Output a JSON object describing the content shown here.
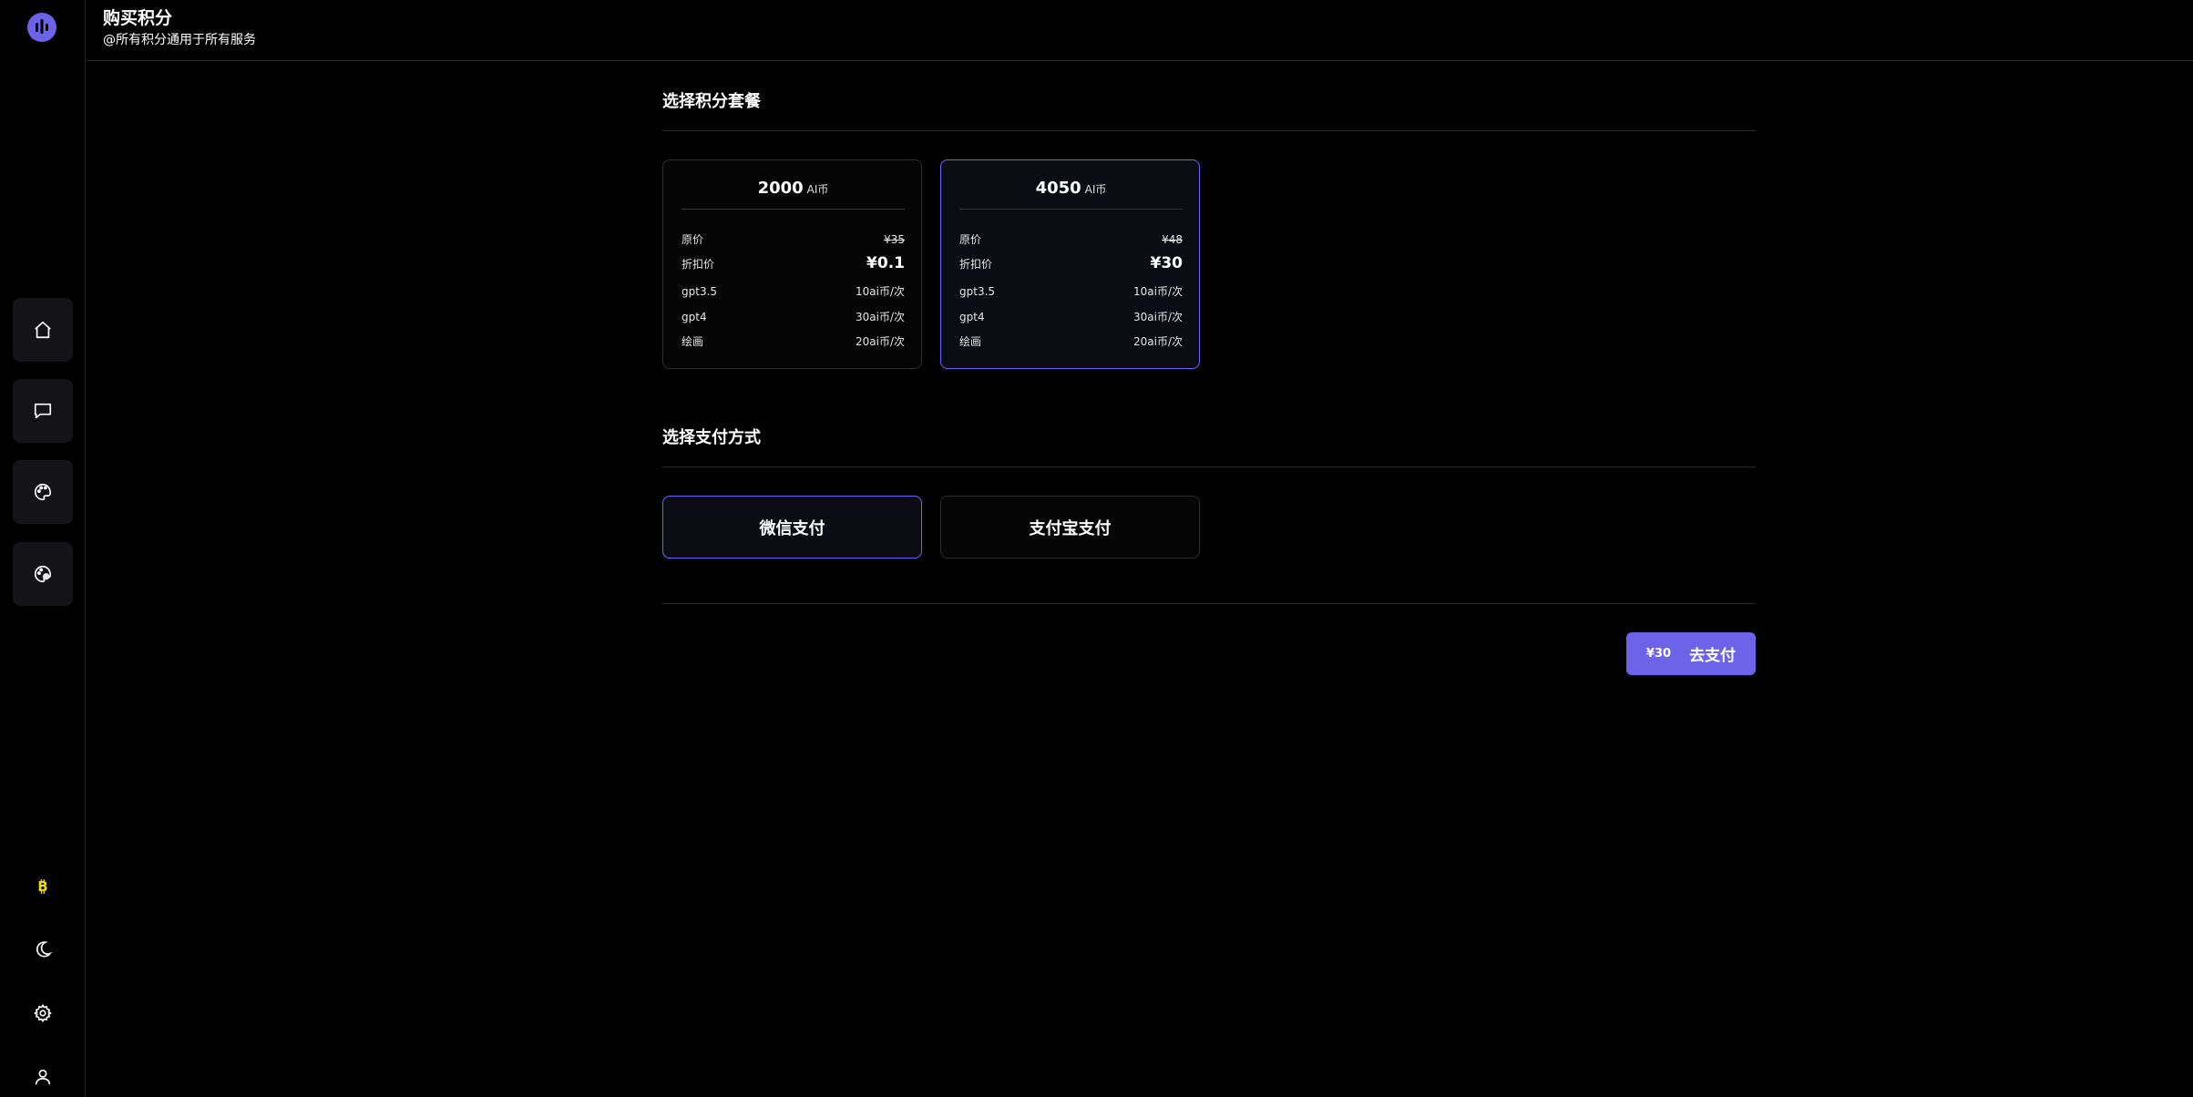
{
  "header": {
    "title": "购买积分",
    "subtitle": "@所有积分通用于所有服务"
  },
  "sidebar": {
    "logo_icon": "waveform-bubble-icon",
    "nav": [
      {
        "icon": "home-icon"
      },
      {
        "icon": "chat-icon"
      },
      {
        "icon": "palette-icon"
      },
      {
        "icon": "palette-settings-icon"
      }
    ],
    "bottom": [
      {
        "icon": "bitcoin-icon"
      },
      {
        "icon": "moon-icon"
      },
      {
        "icon": "gear-icon"
      },
      {
        "icon": "user-icon"
      }
    ]
  },
  "plans_section": {
    "title": "选择积分套餐",
    "plans": [
      {
        "amount": "2000",
        "unit": "AI币",
        "original_label": "原价",
        "original_price": "¥35",
        "discount_label": "折扣价",
        "discount_price": "¥0.1",
        "rows": [
          {
            "label": "gpt3.5",
            "value": "10ai币/次"
          },
          {
            "label": "gpt4",
            "value": "30ai币/次"
          },
          {
            "label": "绘画",
            "value": "20ai币/次"
          }
        ],
        "selected": false
      },
      {
        "amount": "4050",
        "unit": "AI币",
        "original_label": "原价",
        "original_price": "¥48",
        "discount_label": "折扣价",
        "discount_price": "¥30",
        "rows": [
          {
            "label": "gpt3.5",
            "value": "10ai币/次"
          },
          {
            "label": "gpt4",
            "value": "30ai币/次"
          },
          {
            "label": "绘画",
            "value": "20ai币/次"
          }
        ],
        "selected": true
      }
    ]
  },
  "payment_section": {
    "title": "选择支付方式",
    "methods": [
      {
        "label": "微信支付",
        "selected": true
      },
      {
        "label": "支付宝支付",
        "selected": false
      }
    ]
  },
  "checkout": {
    "amount": "¥30",
    "label": "去支付"
  },
  "colors": {
    "accent": "#6c63e8",
    "background": "#000000",
    "bitcoin": "#f0e000"
  }
}
